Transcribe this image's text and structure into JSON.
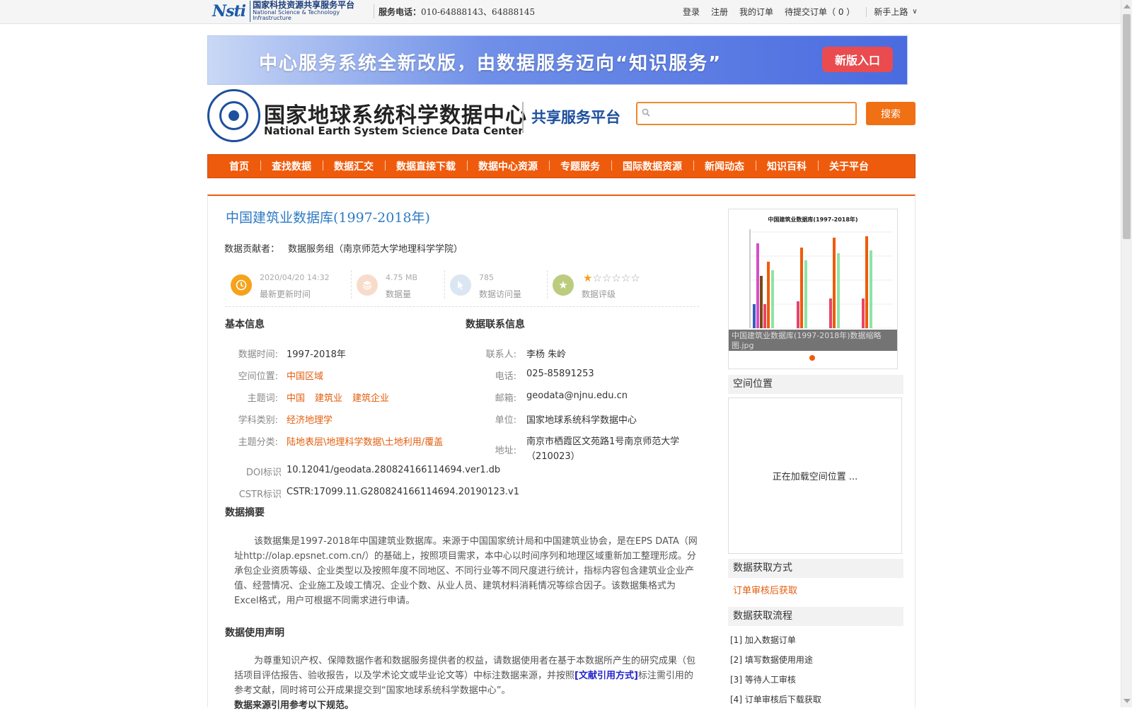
{
  "topbar": {
    "logo_cn": "国家科技资源共享服务平台",
    "logo_en": "National Science & Technology Infrastructure",
    "logo_mark": "Nsti",
    "service_label": "服务电话：",
    "service_tel": "010-64888143、64888145",
    "links": [
      "登录",
      "注册",
      "我的订单",
      "待提交订单（ 0 ）"
    ],
    "newbie": "新手上路"
  },
  "banner": {
    "text": "中心服务系统全新改版，由数据服务迈向“知识服务”",
    "button": "新版入口"
  },
  "brand": {
    "cn": "国家地球系统科学数据中心",
    "en": "National Earth System Science Data Center",
    "platform": "共享服务平台"
  },
  "search": {
    "placeholder": "",
    "value": "",
    "button": "搜索"
  },
  "nav": [
    "首页",
    "查找数据",
    "数据汇交",
    "数据直接下载",
    "数据中心资源",
    "专题服务",
    "国际数据资源",
    "新闻动态",
    "知识百科",
    "关于平台"
  ],
  "dataset": {
    "title": "中国建筑业数据库(1997-2018年)",
    "contributor_label": "数据贡献者：",
    "contributor": "数据服务组（南京师范大学地理科学学院）"
  },
  "stats": {
    "updated": {
      "value": "2020/04/20 14:32",
      "label": "最新更新时间"
    },
    "size": {
      "value": "4.75 MB",
      "label": "数据量"
    },
    "visits": {
      "value": "785",
      "label": "数据访问量"
    },
    "rating": {
      "label": "数据评级",
      "stars": 1,
      "max": 6
    }
  },
  "basic": {
    "heading": "基本信息",
    "time_label": "数据时间:",
    "time": "1997-2018年",
    "space_label": "空间位置:",
    "space": "中国区域",
    "keywords_label": "主题词:",
    "keywords": [
      "中国",
      "建筑业",
      "建筑企业"
    ],
    "discipline_label": "学科类别:",
    "discipline": "经济地理学",
    "category_label": "主题分类:",
    "category": "陆地表层\\地理科学数据\\土地利用/覆盖",
    "doi_label": "DOI标识",
    "doi": "10.12041/geodata.280824166114694.ver1.db",
    "cstr_label": "CSTR标识",
    "cstr": "CSTR:17099.11.G280824166114694.20190123.v1"
  },
  "contact": {
    "heading": "数据联系信息",
    "person_label": "联系人:",
    "person": "李杨 朱岭",
    "phone_label": "电话:",
    "phone": "025-85891253",
    "email_label": "邮箱:",
    "email": "geodata@njnu.edu.cn",
    "org_label": "单位:",
    "org": "国家地球系统科学数据中心",
    "addr_label": "地址:",
    "addr1": "南京市栖霞区文苑路1号南京师范大学",
    "addr2": "（210023）"
  },
  "abstract": {
    "heading": "数据摘要",
    "text": "该数据集是1997-2018年中国建筑业数据库。来源于中国国家统计局和中国建筑业协会，是在EPS DATA（网址http://olap.epsnet.com.cn/）的基础上，按照项目需求，本中心以时间序列和地理区域重新加工整理形成。分承包企业资质等级、企业类型以及按照年度不同地区、不同行业等不同尺度进行统计，指标内容包含建筑业企业产值、经营情况、企业施工及竣工情况、企业个数、从业人员、建筑材料消耗情况等综合因子。该数据集格式为Excel格式，用户可根据不同需求进行申请。"
  },
  "usage": {
    "heading": "数据使用声明",
    "text_a": "为尊重知识产权、保障数据作者和数据服务提供者的权益，请数据使用者在基于本数据所产生的研究成果（包括项目评估报告、验收报告，以及学术论文或毕业论文等）中标注数据来源，并按照",
    "cite": "[文献引用方式]",
    "text_b": "标注需引用的参考文献，同时将可公开成果提交到“国家地球系统科学数据中心”。",
    "line2": "数据来源引用参考以下规范。"
  },
  "thumbnail": {
    "chart_title": "中国建筑业数据库(1997-2018年)",
    "caption": "中国建筑业数据库(1997-2018年)数据缩略图.jpg"
  },
  "sidebar": {
    "space_heading": "空间位置",
    "map_loading": "正在加载空间位置 ...",
    "access_heading": "数据获取方式",
    "access_link": "订单审核后获取",
    "flow_heading": "数据获取流程",
    "steps": [
      "[1] 加入数据订单",
      "[2] 填写数据使用用途",
      "[3] 等待人工审核",
      "[4] 订单审核后下载获取"
    ]
  },
  "colors": {
    "accent": "#ef5b0c",
    "title_blue": "#2e7bc4",
    "link_orange": "#e35d0c"
  }
}
